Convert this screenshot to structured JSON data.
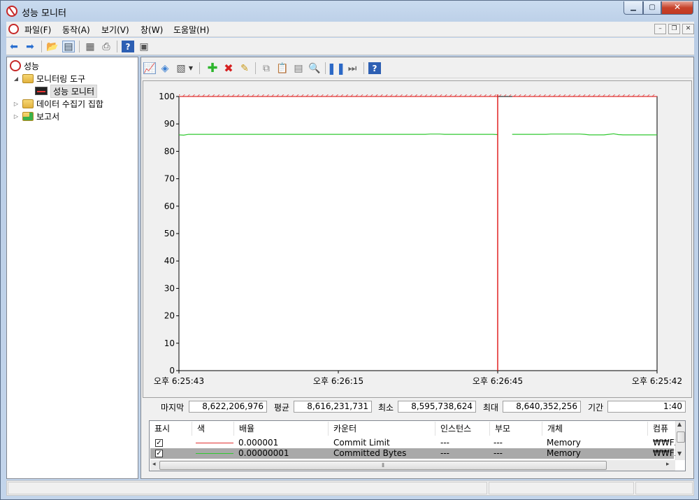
{
  "window": {
    "title": "성능 모니터"
  },
  "menu": {
    "items": [
      "파일(F)",
      "동작(A)",
      "보기(V)",
      "창(W)",
      "도움말(H)"
    ]
  },
  "tree": {
    "root": "성능",
    "monitoring_tools": "모니터링 도구",
    "perf_monitor": "성능 모니터",
    "data_collector_sets": "데이터 수집기 집합",
    "reports": "보고서"
  },
  "stats": {
    "last_label": "마지막",
    "last": "8,622,206,976",
    "avg_label": "평균",
    "avg": "8,616,231,731",
    "min_label": "최소",
    "min": "8,595,738,624",
    "max_label": "최대",
    "max": "8,640,352,256",
    "duration_label": "기간",
    "duration": "1:40"
  },
  "counter_table": {
    "headers": [
      "표시",
      "색",
      "배율",
      "카운터",
      "인스턴스",
      "부모",
      "개체",
      "컴퓨"
    ],
    "rows": [
      {
        "show": "✓",
        "color": "#e03030",
        "scale": "0.000001",
        "counter": "Commit Limit",
        "instance": "---",
        "parent": "---",
        "object": "Memory",
        "computer": "₩₩FX"
      },
      {
        "show": "✓",
        "color": "#30c830",
        "scale": "0.00000001",
        "counter": "Committed Bytes",
        "instance": "---",
        "parent": "---",
        "object": "Memory",
        "computer": "₩₩FX"
      }
    ]
  },
  "colors": {
    "commit_limit": "#e03030",
    "committed_bytes": "#30c830",
    "time_cursor": "#e02020"
  },
  "chart_data": {
    "type": "line",
    "ylim": [
      0,
      100
    ],
    "yticks": [
      "0",
      "10",
      "20",
      "30",
      "40",
      "50",
      "60",
      "70",
      "80",
      "90",
      "100"
    ],
    "xticks": [
      "오후 6:25:43",
      "오후 6:26:15",
      "오후 6:26:45",
      "오후 6:25:42"
    ],
    "series": [
      {
        "name": "Commit Limit",
        "color": "#e03030",
        "values": [
          100,
          100,
          100,
          100,
          100,
          100,
          100,
          100,
          100,
          100,
          100,
          100,
          100,
          100,
          100,
          100,
          100,
          100,
          100,
          100,
          100,
          100,
          100,
          100,
          100,
          100,
          100,
          100,
          100,
          100,
          100,
          100,
          100,
          100,
          100,
          100,
          100,
          100,
          100,
          100,
          100,
          100,
          100,
          100,
          100,
          100,
          100,
          100,
          100,
          100,
          100,
          100,
          100,
          100,
          100,
          100,
          100,
          100,
          100,
          100,
          100,
          100,
          100,
          100,
          100,
          100,
          100,
          100,
          100,
          100,
          100,
          100,
          100,
          100,
          100,
          100,
          100,
          100,
          100,
          100,
          100,
          100,
          100,
          100,
          100,
          100,
          100,
          100,
          100,
          100,
          100,
          100,
          100,
          100,
          100,
          100,
          100,
          100,
          100,
          100
        ]
      },
      {
        "name": "Committed Bytes",
        "color": "#30c830",
        "values": [
          86.0,
          85.9,
          86.2,
          86.2,
          86.2,
          86.2,
          86.2,
          86.2,
          86.2,
          86.2,
          86.2,
          86.2,
          86.2,
          86.2,
          86.2,
          86.2,
          86.2,
          86.2,
          86.2,
          86.2,
          86.2,
          86.2,
          86.2,
          86.2,
          86.2,
          86.2,
          86.2,
          86.2,
          86.2,
          86.2,
          86.2,
          86.2,
          86.2,
          86.2,
          86.2,
          86.2,
          86.2,
          86.2,
          86.2,
          86.2,
          86.2,
          86.2,
          86.2,
          86.2,
          86.2,
          86.2,
          86.2,
          86.2,
          86.2,
          86.2,
          86.2,
          86.2,
          86.3,
          86.3,
          86.3,
          86.2,
          86.2,
          86.2,
          86.2,
          86.2,
          86.2,
          86.2,
          86.2,
          86.2,
          86.2,
          86.2,
          86.1,
          86.1,
          86.2,
          86.2,
          86.2,
          86.2,
          86.2,
          86.2,
          86.2,
          86.2,
          86.2,
          86.3,
          86.3,
          86.3,
          86.3,
          86.3,
          86.3,
          86.3,
          86.2,
          86.0,
          86.0,
          86.0,
          86.0,
          86.2,
          86.4,
          86.1,
          86.0,
          86.0,
          86.0,
          86.0,
          86.0,
          86.0,
          86.0,
          86.0
        ]
      }
    ],
    "cursor_index": 66,
    "gap_after_cursor": 2
  }
}
